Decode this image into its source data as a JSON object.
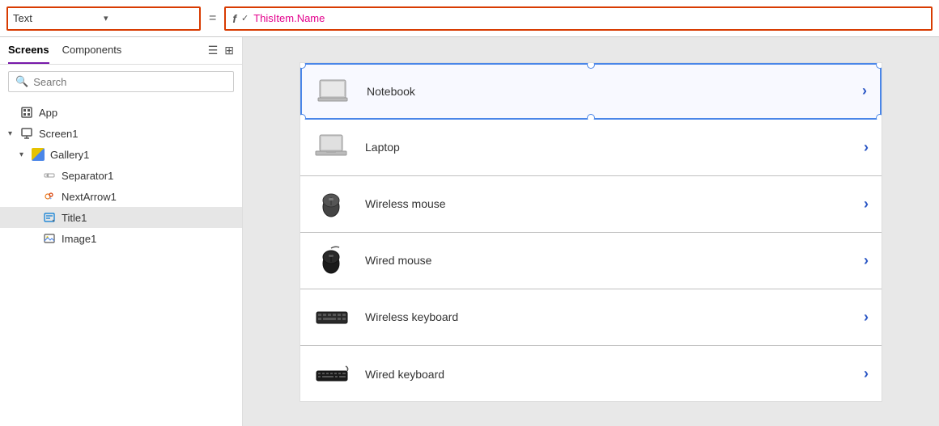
{
  "topbar": {
    "property_label": "Text",
    "chevron": "▾",
    "equals": "=",
    "formula_icon": "f",
    "formula_text": "ThisItem.Name"
  },
  "sidebar": {
    "tabs": [
      {
        "id": "screens",
        "label": "Screens",
        "active": true
      },
      {
        "id": "components",
        "label": "Components",
        "active": false
      }
    ],
    "search_placeholder": "Search",
    "tree": [
      {
        "id": "app",
        "label": "App",
        "level": 0,
        "icon": "app",
        "expanded": false,
        "arrow": ""
      },
      {
        "id": "screen1",
        "label": "Screen1",
        "level": 0,
        "icon": "screen",
        "expanded": true,
        "arrow": "▾"
      },
      {
        "id": "gallery1",
        "label": "Gallery1",
        "level": 1,
        "icon": "gallery",
        "expanded": true,
        "arrow": "▾"
      },
      {
        "id": "separator1",
        "label": "Separator1",
        "level": 2,
        "icon": "separator",
        "expanded": false,
        "arrow": ""
      },
      {
        "id": "nextarrow1",
        "label": "NextArrow1",
        "level": 2,
        "icon": "nextarrow",
        "expanded": false,
        "arrow": ""
      },
      {
        "id": "title1",
        "label": "Title1",
        "level": 2,
        "icon": "title",
        "expanded": false,
        "arrow": "",
        "selected": true
      },
      {
        "id": "image1",
        "label": "Image1",
        "level": 2,
        "icon": "image",
        "expanded": false,
        "arrow": ""
      }
    ]
  },
  "gallery": {
    "items": [
      {
        "id": "notebook",
        "name": "Notebook",
        "selected": true
      },
      {
        "id": "laptop",
        "name": "Laptop",
        "selected": false
      },
      {
        "id": "wireless-mouse",
        "name": "Wireless mouse",
        "selected": false
      },
      {
        "id": "wired-mouse",
        "name": "Wired mouse",
        "selected": false
      },
      {
        "id": "wireless-keyboard",
        "name": "Wireless keyboard",
        "selected": false
      },
      {
        "id": "wired-keyboard",
        "name": "Wired keyboard",
        "selected": false
      }
    ]
  }
}
